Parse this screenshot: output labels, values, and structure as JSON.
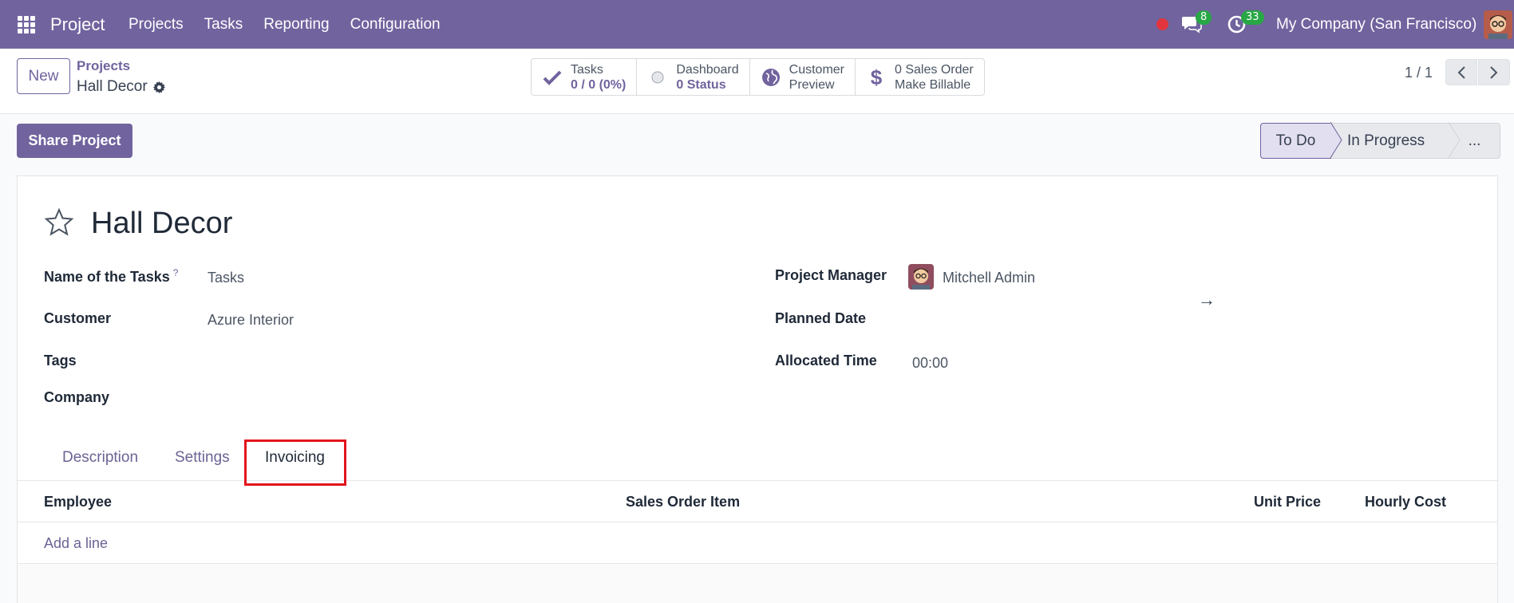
{
  "navbar": {
    "brand": "Project",
    "menu": [
      "Projects",
      "Tasks",
      "Reporting",
      "Configuration"
    ],
    "chat_count": "8",
    "activity_count": "33",
    "company": "My Company (San Francisco)",
    "color": "#71639e"
  },
  "control": {
    "new_label": "New",
    "breadcrumb_parent": "Projects",
    "breadcrumb_current": "Hall Decor",
    "stats": [
      {
        "icon": "check-icon",
        "title": "Tasks",
        "value": "0 / 0 (0%)"
      },
      {
        "icon": "status-dot-icon",
        "title": "Dashboard",
        "value": "0 Status"
      },
      {
        "icon": "globe-icon",
        "title": "Customer",
        "value": "Preview"
      },
      {
        "icon": "dollar-icon",
        "title": "0 Sales Order",
        "value": "Make Billable"
      }
    ],
    "pager": "1 / 1"
  },
  "statusbar": {
    "share_label": "Share Project",
    "stages": [
      "To Do",
      "In Progress",
      "..."
    ],
    "active_stage": "To Do"
  },
  "form": {
    "title": "Hall Decor",
    "left_fields": [
      {
        "label": "Name of the Tasks",
        "help": "?",
        "value": "Tasks"
      },
      {
        "label": "Customer",
        "value": "Azure Interior"
      },
      {
        "label": "Tags",
        "value": ""
      },
      {
        "label": "Company",
        "value": ""
      }
    ],
    "right_fields": [
      {
        "label": "Project Manager",
        "value": "Mitchell Admin"
      },
      {
        "label": "Planned Date",
        "value": "",
        "arrow": "→"
      },
      {
        "label": "Allocated Time",
        "value": "00:00"
      }
    ],
    "tabs": [
      "Description",
      "Settings",
      "Invoicing"
    ],
    "active_tab": "Invoicing",
    "table_headers": [
      "Employee",
      "Sales Order Item",
      "Unit Price",
      "Hourly Cost"
    ],
    "add_line": "Add a line"
  }
}
